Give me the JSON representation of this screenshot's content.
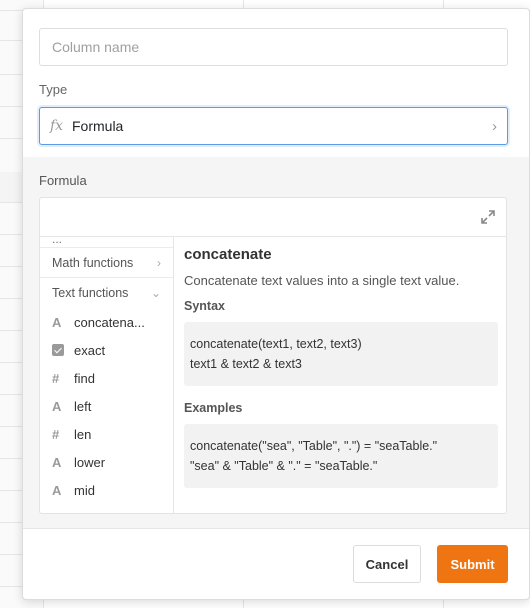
{
  "column_name": {
    "placeholder": "Column name",
    "value": ""
  },
  "type": {
    "label": "Type",
    "value": "Formula",
    "icon": "fx-icon"
  },
  "formula": {
    "label": "Formula",
    "categories": [
      {
        "label": "Math functions",
        "expanded": false
      },
      {
        "label": "Text functions",
        "expanded": true
      }
    ],
    "functions": [
      {
        "name": "concatena...",
        "icon": "text-icon"
      },
      {
        "name": "exact",
        "icon": "checkbox-icon"
      },
      {
        "name": "find",
        "icon": "number-icon"
      },
      {
        "name": "left",
        "icon": "text-icon"
      },
      {
        "name": "len",
        "icon": "number-icon"
      },
      {
        "name": "lower",
        "icon": "text-icon"
      },
      {
        "name": "mid",
        "icon": "text-icon"
      }
    ],
    "doc": {
      "title": "concatenate",
      "description": "Concatenate text values into a single text value.",
      "syntax_label": "Syntax",
      "syntax_lines": [
        "concatenate(text1, text2, text3)",
        "text1 & text2 & text3"
      ],
      "examples_label": "Examples",
      "example_lines": [
        "concatenate(\"sea\", \"Table\", \".\") = \"seaTable.\"",
        "\"sea\" & \"Table\" & \".\" = \"seaTable.\""
      ]
    }
  },
  "buttons": {
    "cancel": "Cancel",
    "submit": "Submit"
  },
  "colors": {
    "accent": "#ee7512",
    "focus": "#5a9be8"
  }
}
